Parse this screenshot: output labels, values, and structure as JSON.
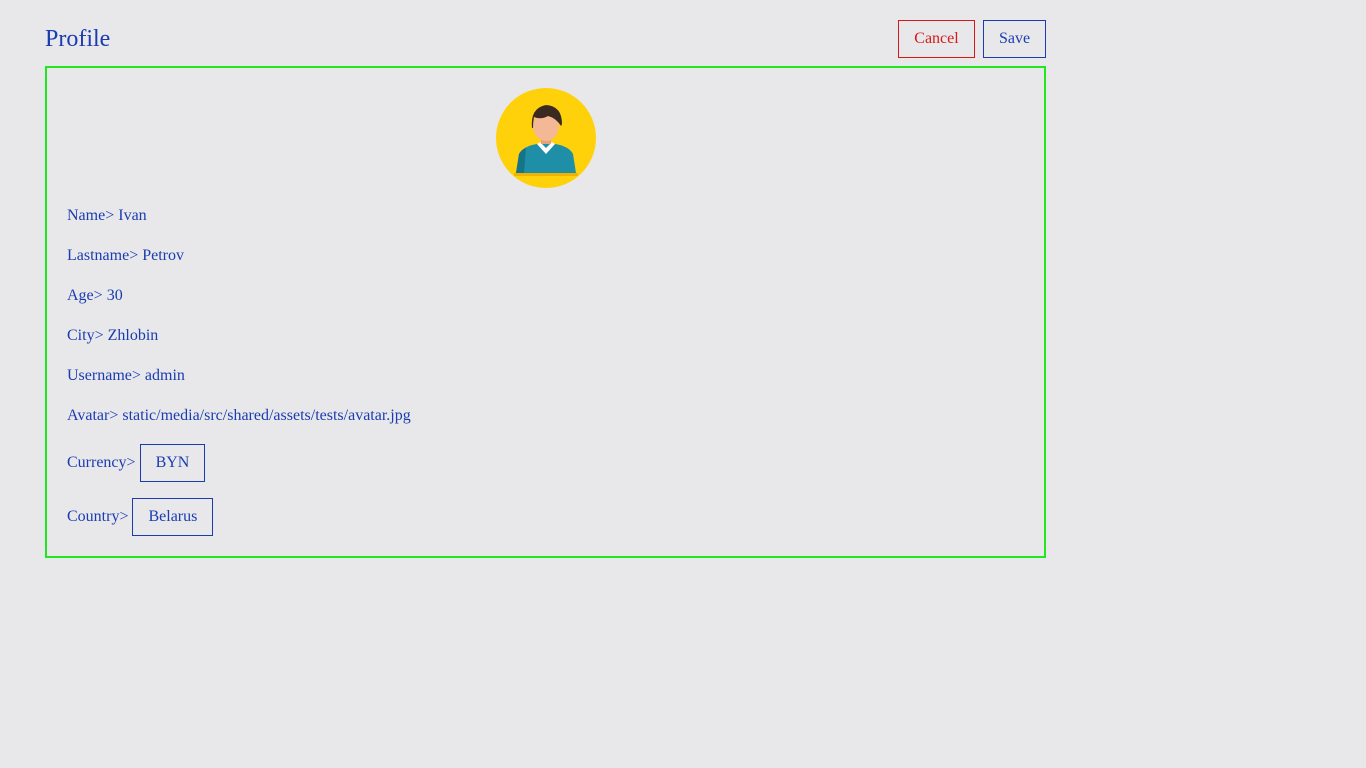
{
  "header": {
    "title": "Profile",
    "cancel_label": "Cancel",
    "save_label": "Save"
  },
  "colors": {
    "text": "#1a3cb0",
    "cancel": "#d61a1a",
    "card_border": "#22e622",
    "avatar_bg": "#ffd10a",
    "page_bg": "#e8e8eb"
  },
  "profile": {
    "name": {
      "label": "Name>",
      "value": "Ivan"
    },
    "lastname": {
      "label": "Lastname>",
      "value": "Petrov"
    },
    "age": {
      "label": "Age>",
      "value": "30"
    },
    "city": {
      "label": "City>",
      "value": "Zhlobin"
    },
    "username": {
      "label": "Username>",
      "value": "admin"
    },
    "avatar": {
      "label": "Avatar>",
      "value": "static/media/src/shared/assets/tests/avatar.jpg"
    },
    "currency": {
      "label": "Currency>",
      "value": "BYN"
    },
    "country": {
      "label": "Country>",
      "value": "Belarus"
    }
  },
  "avatar_image": {
    "icon": "user-avatar-icon"
  }
}
